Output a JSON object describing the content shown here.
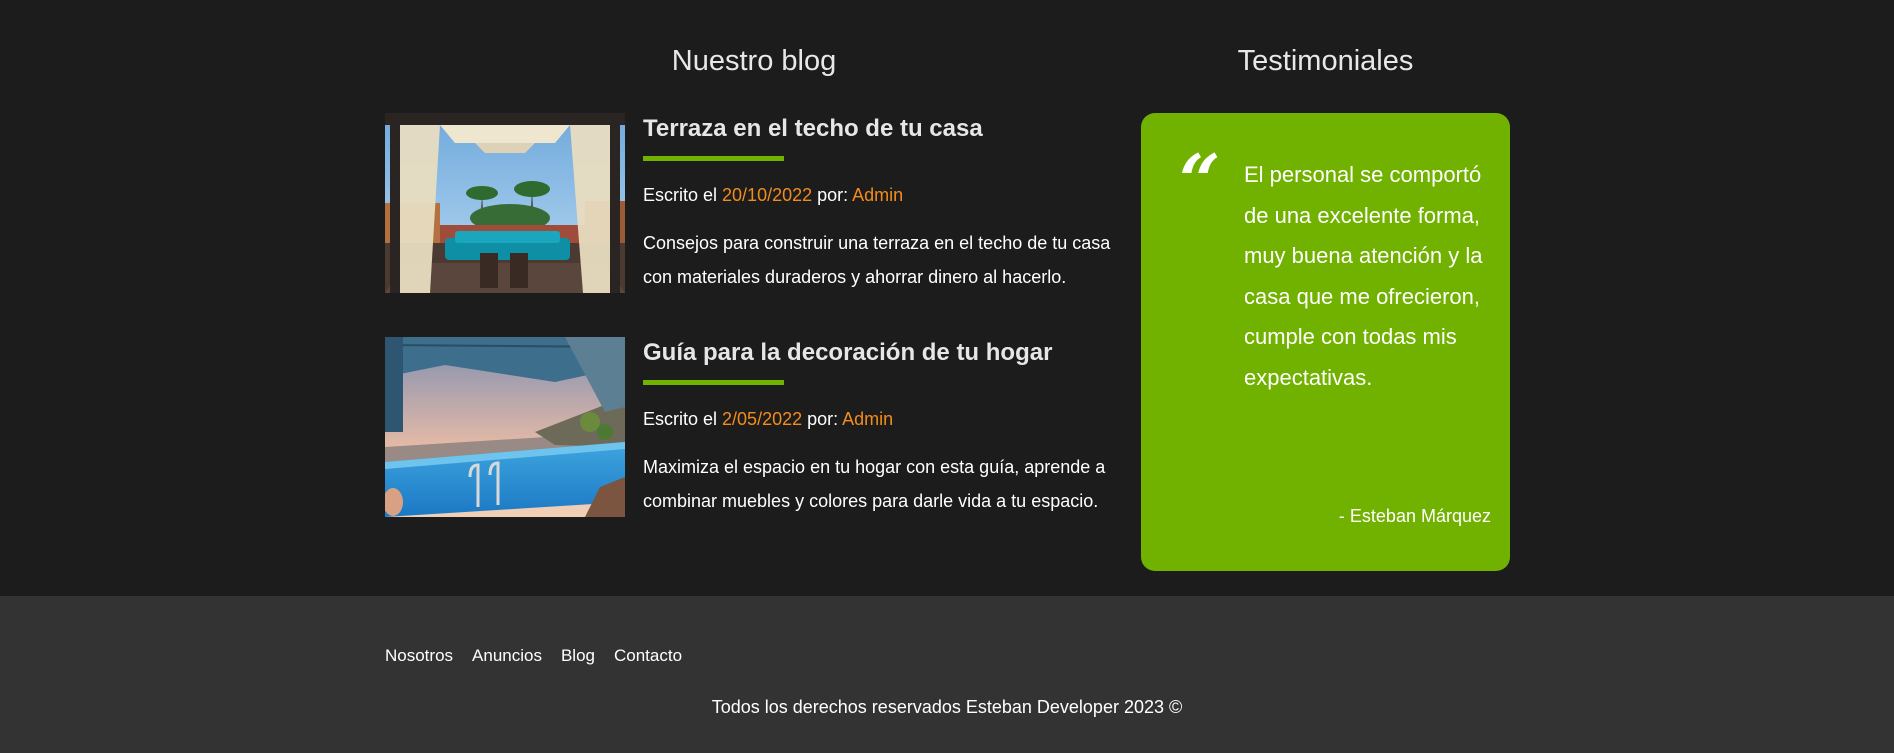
{
  "blog": {
    "title": "Nuestro blog",
    "entries": [
      {
        "title": "Terraza en el techo de tu casa",
        "meta_prefix": "Escrito el ",
        "date": "20/10/2022",
        "meta_by": " por: ",
        "author": "Admin",
        "text": "Consejos para construir una terraza en el techo de tu casa con materiales duraderos y ahorrar dinero al hacerlo."
      },
      {
        "title": "Guía para la decoración de tu hogar",
        "meta_prefix": "Escrito el ",
        "date": "2/05/2022",
        "meta_by": " por: ",
        "author": "Admin",
        "text": "Maximiza el espacio en tu hogar con esta guía, aprende a combinar muebles y colores para darle vida a tu espacio."
      }
    ]
  },
  "testimonials": {
    "title": "Testimoniales",
    "quote_mark": "“",
    "text": "El personal se comportó de una excelente forma, muy buena atención y la casa que me ofrecieron, cumple con todas mis expectativas.",
    "author": "- Esteban Márquez"
  },
  "footer": {
    "nav": [
      "Nosotros",
      "Anuncios",
      "Blog",
      "Contacto"
    ],
    "copyright": "Todos los derechos reservados Esteban Developer 2023 ©"
  },
  "colors": {
    "accent_green": "#71b100",
    "accent_orange": "#f28c1c",
    "background_dark": "#1c1c1c",
    "footer_background": "#333333"
  }
}
